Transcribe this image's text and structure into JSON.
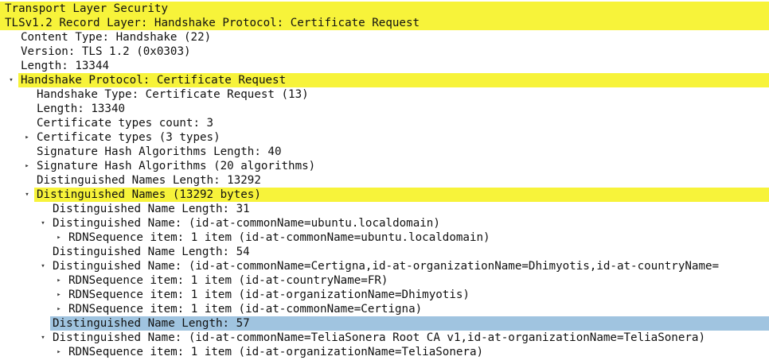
{
  "colors": {
    "highlight": "#f7f33a",
    "selected": "#a0c4e0",
    "text": "#111111"
  },
  "icons": {
    "expanded": "▾",
    "collapsed": "▸"
  },
  "rows": [
    {
      "level": 0,
      "toggle": "none",
      "hl": "highlight",
      "label": "Transport Layer Security"
    },
    {
      "level": 0,
      "toggle": "expanded",
      "hl": "highlight",
      "label": "TLSv1.2 Record Layer: Handshake Protocol: Certificate Request"
    },
    {
      "level": 1,
      "toggle": "none",
      "hl": "none",
      "label": "Content Type: Handshake (22)"
    },
    {
      "level": 1,
      "toggle": "none",
      "hl": "none",
      "label": "Version: TLS 1.2 (0x0303)"
    },
    {
      "level": 1,
      "toggle": "none",
      "hl": "none",
      "label": "Length: 13344"
    },
    {
      "level": 1,
      "toggle": "expanded",
      "hl": "highlight",
      "label": "Handshake Protocol: Certificate Request"
    },
    {
      "level": 2,
      "toggle": "none",
      "hl": "none",
      "label": "Handshake Type: Certificate Request (13)"
    },
    {
      "level": 2,
      "toggle": "none",
      "hl": "none",
      "label": "Length: 13340"
    },
    {
      "level": 2,
      "toggle": "none",
      "hl": "none",
      "label": "Certificate types count: 3"
    },
    {
      "level": 2,
      "toggle": "collapsed",
      "hl": "none",
      "label": "Certificate types (3 types)"
    },
    {
      "level": 2,
      "toggle": "none",
      "hl": "none",
      "label": "Signature Hash Algorithms Length: 40"
    },
    {
      "level": 2,
      "toggle": "collapsed",
      "hl": "none",
      "label": "Signature Hash Algorithms (20 algorithms)"
    },
    {
      "level": 2,
      "toggle": "none",
      "hl": "none",
      "label": "Distinguished Names Length: 13292"
    },
    {
      "level": 2,
      "toggle": "expanded",
      "hl": "highlight",
      "label": "Distinguished Names (13292 bytes)"
    },
    {
      "level": 3,
      "toggle": "none",
      "hl": "none",
      "label": "Distinguished Name Length: 31"
    },
    {
      "level": 3,
      "toggle": "expanded",
      "hl": "none",
      "label": "Distinguished Name: (id-at-commonName=ubuntu.localdomain)"
    },
    {
      "level": 4,
      "toggle": "collapsed",
      "hl": "none",
      "label": "RDNSequence item: 1 item (id-at-commonName=ubuntu.localdomain)"
    },
    {
      "level": 3,
      "toggle": "none",
      "hl": "none",
      "label": "Distinguished Name Length: 54"
    },
    {
      "level": 3,
      "toggle": "expanded",
      "hl": "none",
      "label": "Distinguished Name: (id-at-commonName=Certigna,id-at-organizationName=Dhimyotis,id-at-countryName="
    },
    {
      "level": 4,
      "toggle": "collapsed",
      "hl": "none",
      "label": "RDNSequence item: 1 item (id-at-countryName=FR)"
    },
    {
      "level": 4,
      "toggle": "collapsed",
      "hl": "none",
      "label": "RDNSequence item: 1 item (id-at-organizationName=Dhimyotis)"
    },
    {
      "level": 4,
      "toggle": "collapsed",
      "hl": "none",
      "label": "RDNSequence item: 1 item (id-at-commonName=Certigna)"
    },
    {
      "level": 3,
      "toggle": "none",
      "hl": "selected",
      "label": "Distinguished Name Length: 57"
    },
    {
      "level": 3,
      "toggle": "expanded",
      "hl": "none",
      "label": "Distinguished Name: (id-at-commonName=TeliaSonera Root CA v1,id-at-organizationName=TeliaSonera)"
    },
    {
      "level": 4,
      "toggle": "collapsed",
      "hl": "none",
      "label": "RDNSequence item: 1 item (id-at-organizationName=TeliaSonera)"
    }
  ]
}
